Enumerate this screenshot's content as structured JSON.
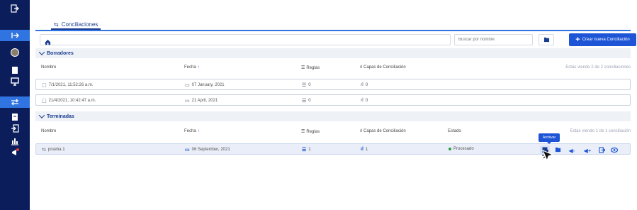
{
  "sidebar": {
    "icons": [
      "logout-icon",
      "collapse-icon",
      "avatar",
      "document-icon",
      "monitor-icon",
      "reconcile-icon",
      "archive-icon",
      "import-icon",
      "chart-icon",
      "announce-icon"
    ]
  },
  "tab": {
    "label": "Conciliaciones"
  },
  "toolbar": {
    "search_placeholder": "Buscar por nombre",
    "create_label": "Crear nueva Conciliación"
  },
  "drafts": {
    "title": "Borradores",
    "columns": {
      "name": "Nombre",
      "date": "Fecha",
      "rules": "Reglas",
      "layers": "Capas de Conciliación"
    },
    "summary": "Estás viendo 2 de 2 conciliaciones",
    "rows": [
      {
        "name": "7/1/2021, 11:52:26 a.m.",
        "date": "07 January, 2021",
        "rules": "0",
        "layers": "0"
      },
      {
        "name": "21/4/2021, 10:42:47 a.m.",
        "date": "21 April, 2021",
        "rules": "0",
        "layers": "0"
      }
    ]
  },
  "finished": {
    "title": "Terminadas",
    "columns": {
      "name": "Nombre",
      "date": "Fecha",
      "rules": "Reglas",
      "layers": "Capas de Conciliación",
      "status": "Estado"
    },
    "summary": "Estás viendo 1 de 1 conciliación",
    "rows": [
      {
        "name": "prueba 1",
        "date": "06 September, 2021",
        "rules": "1",
        "layers": "1",
        "status": "Procesado"
      }
    ],
    "tooltip": "Archivar"
  },
  "colors": {
    "accent": "#1d55d6",
    "sidebar": "#0b1e5b",
    "status_ok": "#2e9d45"
  }
}
